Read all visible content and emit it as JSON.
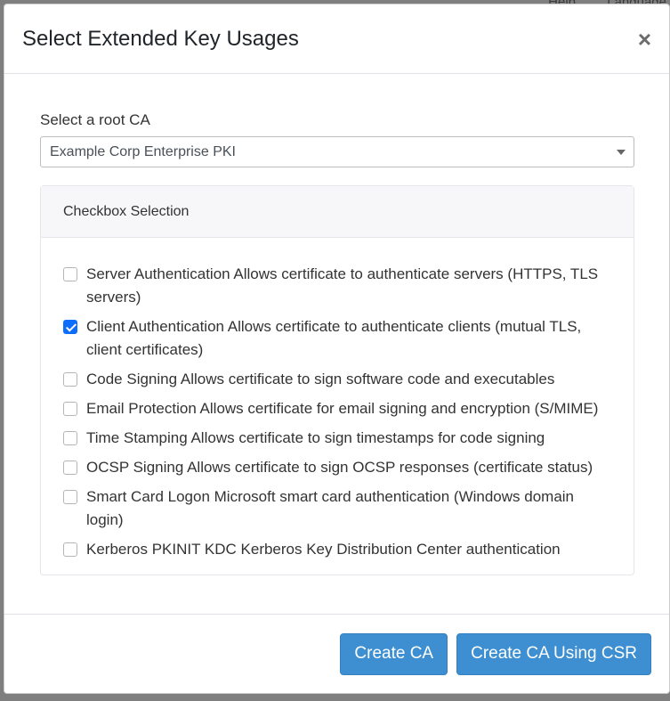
{
  "background": {
    "help_label": "Help",
    "language_label": "Language"
  },
  "modal": {
    "title": "Select Extended Key Usages",
    "close_symbol": "×",
    "root_ca_label": "Select a root CA",
    "root_ca_selected": "Example Corp Enterprise PKI",
    "card_header": "Checkbox Selection",
    "options": [
      {
        "label": "Server Authentication Allows certificate to authenticate servers (HTTPS, TLS servers)",
        "checked": false
      },
      {
        "label": "Client Authentication Allows certificate to authenticate clients (mutual TLS, client certificates)",
        "checked": true
      },
      {
        "label": "Code Signing Allows certificate to sign software code and executables",
        "checked": false
      },
      {
        "label": "Email Protection Allows certificate for email signing and encryption (S/MIME)",
        "checked": false
      },
      {
        "label": "Time Stamping Allows certificate to sign timestamps for code signing",
        "checked": false
      },
      {
        "label": "OCSP Signing Allows certificate to sign OCSP responses (certificate status)",
        "checked": false
      },
      {
        "label": "Smart Card Logon Microsoft smart card authentication (Windows domain login)",
        "checked": false
      },
      {
        "label": "Kerberos PKINIT KDC Kerberos Key Distribution Center authentication",
        "checked": false
      }
    ],
    "buttons": {
      "create_ca": "Create CA",
      "create_ca_csr": "Create CA Using CSR"
    }
  },
  "colors": {
    "primary_button": "#3d8fd1",
    "checkbox_checked": "#0d6efd",
    "backdrop": "#7f7f7f"
  }
}
